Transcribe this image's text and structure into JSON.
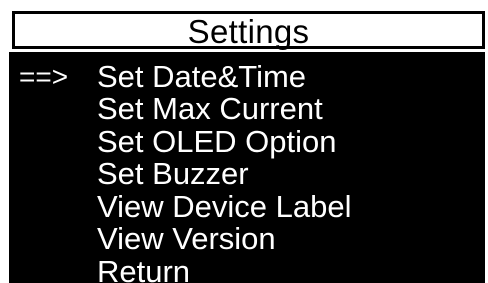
{
  "header": {
    "title": "Settings"
  },
  "menu": {
    "cursor": "==>",
    "selected_index": 0,
    "items": [
      {
        "label": "Set Date&Time"
      },
      {
        "label": "Set Max Current"
      },
      {
        "label": "Set OLED Option"
      },
      {
        "label": "Set Buzzer"
      },
      {
        "label": "View Device Label"
      },
      {
        "label": "View Version"
      },
      {
        "label": "Return"
      }
    ]
  },
  "colors": {
    "background": "#000000",
    "text": "#ffffff",
    "header_background": "#ffffff",
    "header_text": "#000000"
  }
}
